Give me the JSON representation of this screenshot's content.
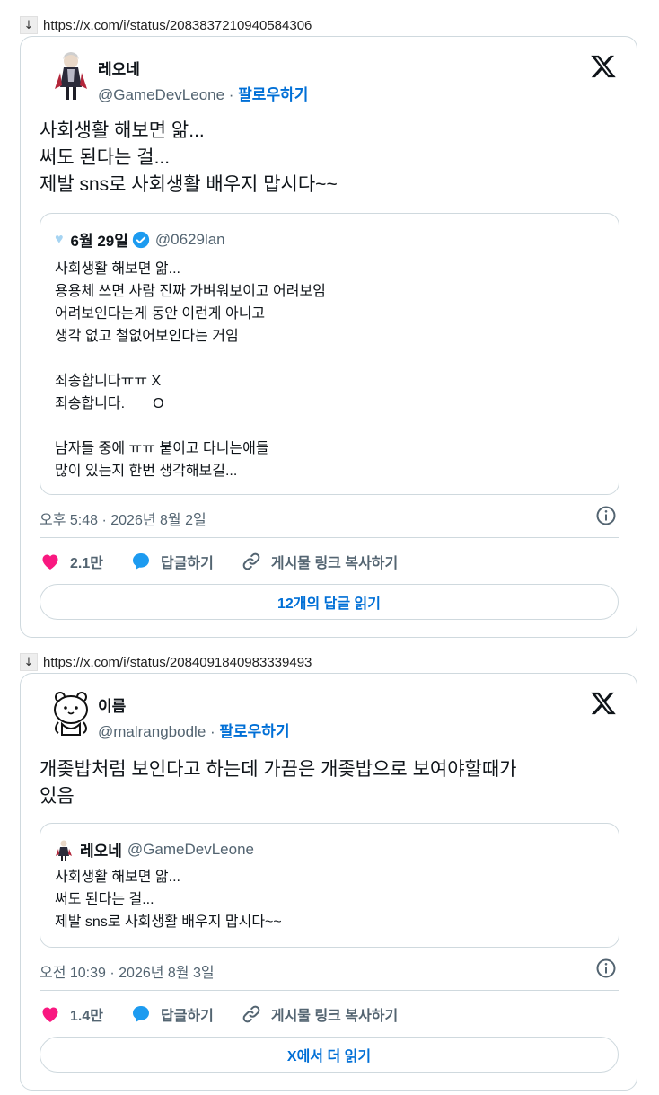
{
  "tweets": [
    {
      "url": "https://x.com/i/status/2083837210940584306",
      "author_name": "레오네",
      "author_handle": "@GameDevLeone",
      "separator": " · ",
      "follow_label": "팔로우하기",
      "text": "사회생활 해보면 앎...\n써도 된다는 걸...\n제발 sns로 사회생활 배우지 맙시다~~",
      "quote": {
        "author_name": "6월 29일",
        "author_handle": "@0629lan",
        "verified": true,
        "text": "사회생활 해보면 앎...\n용용체 쓰면 사람 진짜 가벼워보이고 어려보임\n어려보인다는게 동안 이런게 아니고\n생각 없고 철없어보인다는 거임\n\n죄송합니다ㅠㅠ X\n죄송합니다.       O\n\n남자들 중에 ㅠㅠ 붙이고 다니는애들\n많이 있는지 한번 생각해보길..."
      },
      "timestamp": "오후 5:48 · 2026년 8월 2일",
      "likes": "2.1만",
      "reply_label": "답글하기",
      "copy_link_label": "게시물 링크 복사하기",
      "read_more_label": "12개의 답글 읽기"
    },
    {
      "url": "https://x.com/i/status/2084091840983339493",
      "author_name": "이름",
      "author_handle": "@malrangbodle",
      "separator": " · ",
      "follow_label": "팔로우하기",
      "text": "개좆밥처럼 보인다고 하는데 가끔은 개좆밥으로 보여야할때가\n있음",
      "quote": {
        "author_name": "레오네",
        "author_handle": "@GameDevLeone",
        "verified": false,
        "text": "사회생활 해보면 앎...\n써도 된다는 걸...\n제발 sns로 사회생활 배우지 맙시다~~"
      },
      "timestamp": "오전 10:39 · 2026년 8월 3일",
      "likes": "1.4만",
      "reply_label": "답글하기",
      "copy_link_label": "게시물 링크 복사하기",
      "read_more_label": "X에서 더 읽기"
    }
  ],
  "icons": {
    "download": "down-arrow-icon",
    "x_logo": "x-logo-icon",
    "info": "info-icon",
    "heart": "heart-icon",
    "reply": "speech-bubble-icon",
    "link": "link-icon",
    "verified": "verified-badge-icon"
  },
  "colors": {
    "link_blue": "#006fd6",
    "heart_pink": "#f91880",
    "reply_blue": "#1d9bf0",
    "border": "#cfd9de",
    "muted_text": "#536471"
  }
}
